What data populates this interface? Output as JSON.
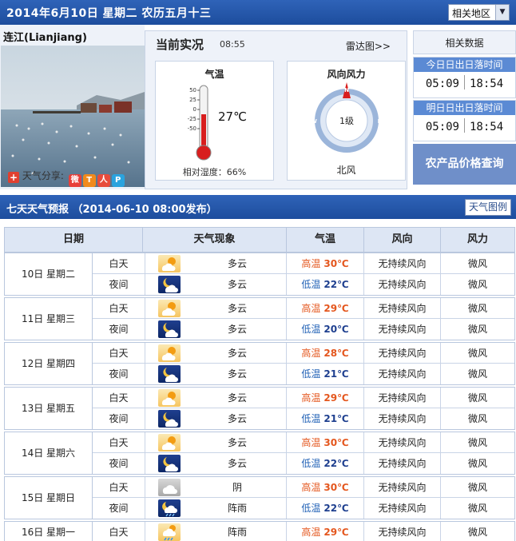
{
  "header": {
    "date_text": "2014年6月10日  星期二  农历五月十三",
    "region_select": "相关地区"
  },
  "city": {
    "name": "连江(Lianjiang)",
    "share_label": "天气分享:"
  },
  "current": {
    "title": "当前实况",
    "time": "08:55",
    "radar_link": "雷达图>>",
    "temp_card_title": "气温",
    "temperature": "27℃",
    "temperature_value": 27,
    "thermometer_ticks": [
      "50",
      "25",
      "0",
      "-25",
      "-50"
    ],
    "humidity": "相对湿度：66%",
    "wind_card_title": "风向风力",
    "wind_level": "1级",
    "wind_direction": "北风",
    "compass": {
      "n": "N",
      "e": "E",
      "s": "S",
      "w": "W"
    }
  },
  "side": {
    "title": "相关数据",
    "today_label": "今日日出日落时间",
    "today_sunrise": "05:09",
    "today_sunset": "18:54",
    "tomorrow_label": "明日日出日落时间",
    "tomorrow_sunrise": "05:09",
    "tomorrow_sunset": "18:54",
    "farm_button": "农产品价格查询"
  },
  "forecast": {
    "title": "七天天气预报  （2014-06-10 08:00发布）",
    "legend_button": "天气图例",
    "columns": [
      "日期",
      "天气现象",
      "气温",
      "风向",
      "风力"
    ],
    "days": [
      {
        "date": "10日 星期二",
        "day": {
          "period": "白天",
          "icon": "partly-cloudy-day-icon",
          "weather": "多云",
          "temp_label": "高温",
          "temp": "30℃",
          "wind_dir": "无持续风向",
          "wind_power": "微风"
        },
        "night": {
          "period": "夜间",
          "icon": "partly-cloudy-night-icon",
          "weather": "多云",
          "temp_label": "低温",
          "temp": "22℃",
          "wind_dir": "无持续风向",
          "wind_power": "微风"
        }
      },
      {
        "date": "11日 星期三",
        "day": {
          "period": "白天",
          "icon": "partly-cloudy-day-icon",
          "weather": "多云",
          "temp_label": "高温",
          "temp": "29℃",
          "wind_dir": "无持续风向",
          "wind_power": "微风"
        },
        "night": {
          "period": "夜间",
          "icon": "partly-cloudy-night-icon",
          "weather": "多云",
          "temp_label": "低温",
          "temp": "20℃",
          "wind_dir": "无持续风向",
          "wind_power": "微风"
        }
      },
      {
        "date": "12日 星期四",
        "day": {
          "period": "白天",
          "icon": "partly-cloudy-day-icon",
          "weather": "多云",
          "temp_label": "高温",
          "temp": "28℃",
          "wind_dir": "无持续风向",
          "wind_power": "微风"
        },
        "night": {
          "period": "夜间",
          "icon": "partly-cloudy-night-icon",
          "weather": "多云",
          "temp_label": "低温",
          "temp": "21℃",
          "wind_dir": "无持续风向",
          "wind_power": "微风"
        }
      },
      {
        "date": "13日 星期五",
        "day": {
          "period": "白天",
          "icon": "partly-cloudy-day-icon",
          "weather": "多云",
          "temp_label": "高温",
          "temp": "29℃",
          "wind_dir": "无持续风向",
          "wind_power": "微风"
        },
        "night": {
          "period": "夜间",
          "icon": "partly-cloudy-night-icon",
          "weather": "多云",
          "temp_label": "低温",
          "temp": "21℃",
          "wind_dir": "无持续风向",
          "wind_power": "微风"
        }
      },
      {
        "date": "14日 星期六",
        "day": {
          "period": "白天",
          "icon": "partly-cloudy-day-icon",
          "weather": "多云",
          "temp_label": "高温",
          "temp": "30℃",
          "wind_dir": "无持续风向",
          "wind_power": "微风"
        },
        "night": {
          "period": "夜间",
          "icon": "partly-cloudy-night-icon",
          "weather": "多云",
          "temp_label": "低温",
          "temp": "22℃",
          "wind_dir": "无持续风向",
          "wind_power": "微风"
        }
      },
      {
        "date": "15日 星期日",
        "day": {
          "period": "白天",
          "icon": "overcast-icon",
          "weather": "阴",
          "temp_label": "高温",
          "temp": "30℃",
          "wind_dir": "无持续风向",
          "wind_power": "微风"
        },
        "night": {
          "period": "夜间",
          "icon": "shower-night-icon",
          "weather": "阵雨",
          "temp_label": "低温",
          "temp": "22℃",
          "wind_dir": "无持续风向",
          "wind_power": "微风"
        }
      },
      {
        "date": "16日 星期一",
        "day": {
          "period": "白天",
          "icon": "shower-day-icon",
          "weather": "阵雨",
          "temp_label": "高温",
          "temp": "29℃",
          "wind_dir": "无持续风向",
          "wind_power": "微风"
        }
      }
    ]
  },
  "colors": {
    "header_blue": "#1d4d9d",
    "high_temp": "#e4561d",
    "low_temp": "#1e5fb5",
    "farm_button": "#6f8fc9"
  }
}
